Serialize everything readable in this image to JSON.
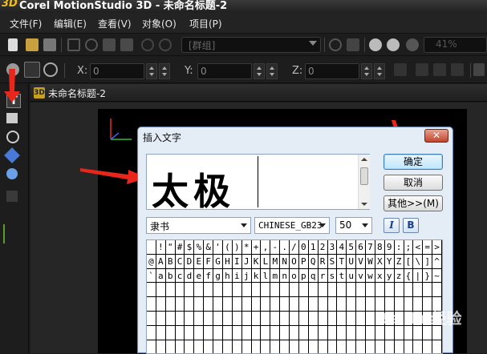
{
  "app": {
    "logo_text": "3D",
    "window_title": "Corel MotionStudio 3D - 未命名标题-2"
  },
  "menu": [
    "文件(F)",
    "编辑(E)",
    "查看(V)",
    "对象(O)",
    "项目(P)"
  ],
  "toolbar": {
    "group_placeholder": "[群组]",
    "zoom_value": "41%",
    "x_label": "X:",
    "x_value": "0",
    "y_label": "Y:",
    "y_value": "0",
    "z_label": "Z:",
    "z_value": "0"
  },
  "document": {
    "icon_text": "3D",
    "tab_title": "未命名标题-2"
  },
  "dialog": {
    "title": "插入文字",
    "close_label": "✕",
    "preview_text": "太极",
    "ok_label": "确定",
    "cancel_label": "取消",
    "more_label": "其他>>(M)",
    "font_value": "隶书",
    "charset_value": "CHINESE_GB23",
    "size_value": "50",
    "italic_label": "I",
    "bold_label": "B",
    "char_rows": [
      " !\"#$%&'()*+,-./0123456789:;<=>?",
      "@ABCDEFGHIJKLMNOPQRSTUVWXYZ[\\]^_",
      "`abcdefghijklmnopqrstuvwxyz{|}~"
    ]
  },
  "watermark": "Baidu 经验",
  "colors": {
    "accent_red": "#e8261c",
    "dialog_bg": "#e4ecf6"
  }
}
